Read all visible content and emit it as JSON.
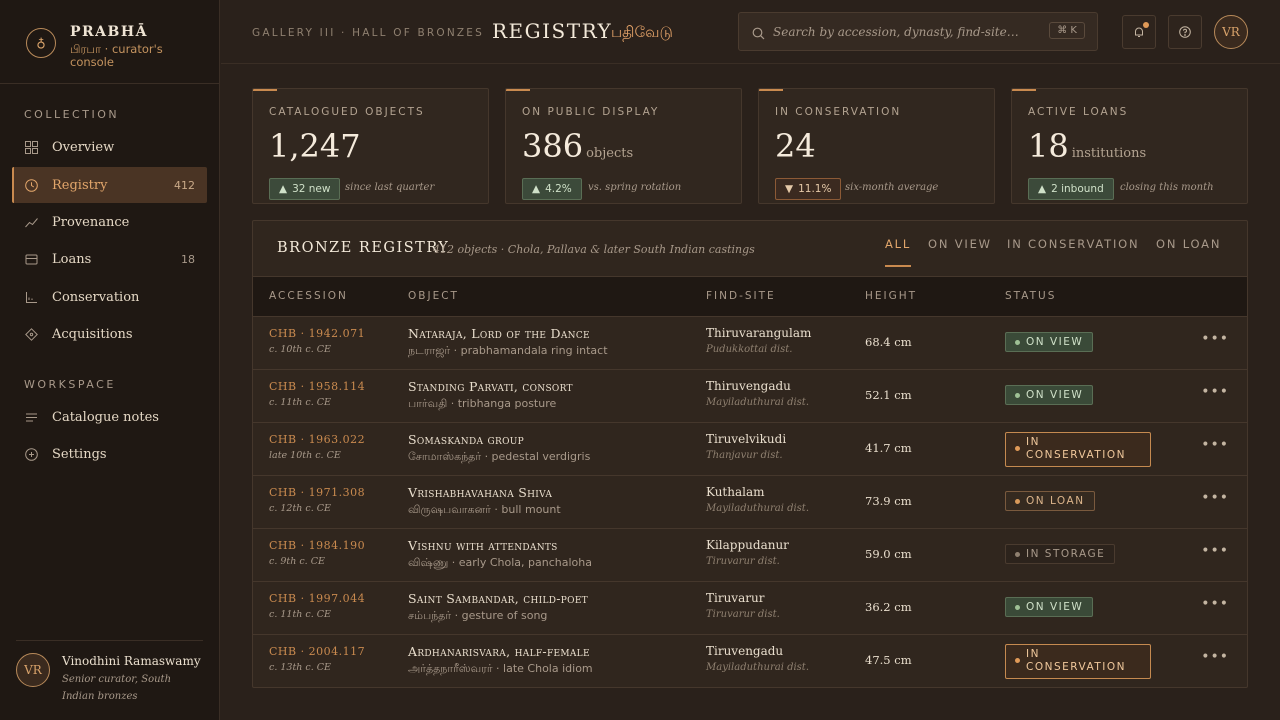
{
  "brand": {
    "title": "PRABHĀ",
    "subtitle": "பிரபா · curator's console",
    "logo_glyph": "♁"
  },
  "sidebar": {
    "collection_label": "COLLECTION",
    "workspace_label": "WORKSPACE",
    "items": [
      {
        "label": "Overview",
        "icon": "grid-icon",
        "count": ""
      },
      {
        "label": "Registry",
        "icon": "clock-icon",
        "count": "412",
        "active": true
      },
      {
        "label": "Provenance",
        "icon": "trend-icon",
        "count": ""
      },
      {
        "label": "Loans",
        "icon": "card-icon",
        "count": "18"
      },
      {
        "label": "Conservation",
        "icon": "chart-icon",
        "count": ""
      },
      {
        "label": "Acquisitions",
        "icon": "diamond-icon",
        "count": ""
      }
    ],
    "workspace_items": [
      {
        "label": "Catalogue notes",
        "icon": "lines-icon"
      },
      {
        "label": "Settings",
        "icon": "plus-circle-icon"
      }
    ],
    "user": {
      "initials": "VR",
      "name": "Vinodhini Ramaswamy",
      "role": "Senior curator, South Indian bronzes"
    }
  },
  "header": {
    "breadcrumb": "GALLERY III · HALL OF BRONZES",
    "title": "REGISTRY",
    "title_tamil": "பதிவேடு",
    "search_placeholder": "Search by accession, dynasty, find-site…",
    "search_shortcut": "⌘ K",
    "avatar_initials": "VR"
  },
  "stats": [
    {
      "label": "CATALOGUED OBJECTS",
      "value": "1,247",
      "unit": "",
      "delta": "32 new",
      "direction": "up",
      "note": "since last quarter"
    },
    {
      "label": "ON PUBLIC DISPLAY",
      "value": "386",
      "unit": "objects",
      "delta": "4.2%",
      "direction": "up",
      "note": "vs. spring rotation"
    },
    {
      "label": "IN CONSERVATION",
      "value": "24",
      "unit": "",
      "delta": "11.1%",
      "direction": "down",
      "note": "six-month average"
    },
    {
      "label": "ACTIVE LOANS",
      "value": "18",
      "unit": "institutions",
      "delta": "2 inbound",
      "direction": "up",
      "note": "closing this month"
    }
  ],
  "registry": {
    "title": "BRONZE REGISTRY",
    "subtitle": "412 objects · Chola, Pallava & later South Indian castings",
    "tabs": [
      "ALL",
      "ON VIEW",
      "IN CONSERVATION",
      "ON LOAN"
    ],
    "active_tab": "ALL",
    "columns": [
      "ACCESSION",
      "OBJECT",
      "FIND-SITE",
      "HEIGHT",
      "STATUS"
    ],
    "rows": [
      {
        "accession": "CHB · 1942.071",
        "era": "c. 10th c. CE",
        "object": "Nataraja, Lord of the Dance",
        "object_sub": "நடராஜர் · prabhamandala ring intact",
        "site": "Thiruvarangulam",
        "district": "Pudukkottai dist.",
        "height": "68.4 cm",
        "status": "ON VIEW",
        "status_kind": "view"
      },
      {
        "accession": "CHB · 1958.114",
        "era": "c. 11th c. CE",
        "object": "Standing Parvati, consort",
        "object_sub": "பார்வதி · tribhanga posture",
        "site": "Thiruvengadu",
        "district": "Mayiladuthurai dist.",
        "height": "52.1 cm",
        "status": "ON VIEW",
        "status_kind": "view"
      },
      {
        "accession": "CHB · 1963.022",
        "era": "late 10th c. CE",
        "object": "Somaskanda group",
        "object_sub": "சோமாஸ்கந்தர் · pedestal verdigris",
        "site": "Tiruvelvikudi",
        "district": "Thanjavur dist.",
        "height": "41.7 cm",
        "status": "IN CONSERVATION",
        "status_kind": "cons"
      },
      {
        "accession": "CHB · 1971.308",
        "era": "c. 12th c. CE",
        "object": "Vrishabhavahana Shiva",
        "object_sub": "விருஷபவாகனர் · bull mount",
        "site": "Kuthalam",
        "district": "Mayiladuthurai dist.",
        "height": "73.9 cm",
        "status": "ON LOAN",
        "status_kind": "loan"
      },
      {
        "accession": "CHB · 1984.190",
        "era": "c. 9th c. CE",
        "object": "Vishnu with attendants",
        "object_sub": "விஷ்ணு · early Chola, panchaloha",
        "site": "Kilappudanur",
        "district": "Tiruvarur dist.",
        "height": "59.0 cm",
        "status": "IN STORAGE",
        "status_kind": "store"
      },
      {
        "accession": "CHB · 1997.044",
        "era": "c. 11th c. CE",
        "object": "Saint Sambandar, child-poet",
        "object_sub": "சம்பந்தர் · gesture of song",
        "site": "Tiruvarur",
        "district": "Tiruvarur dist.",
        "height": "36.2 cm",
        "status": "ON VIEW",
        "status_kind": "view"
      },
      {
        "accession": "CHB · 2004.117",
        "era": "c. 13th c. CE",
        "object": "Ardhanarisvara, half-female",
        "object_sub": "அர்த்தநாரீஸ்வரர் · late Chola idiom",
        "site": "Tiruvengadu",
        "district": "Mayiladuthurai dist.",
        "height": "47.5 cm",
        "status": "IN CONSERVATION",
        "status_kind": "cons"
      }
    ]
  }
}
